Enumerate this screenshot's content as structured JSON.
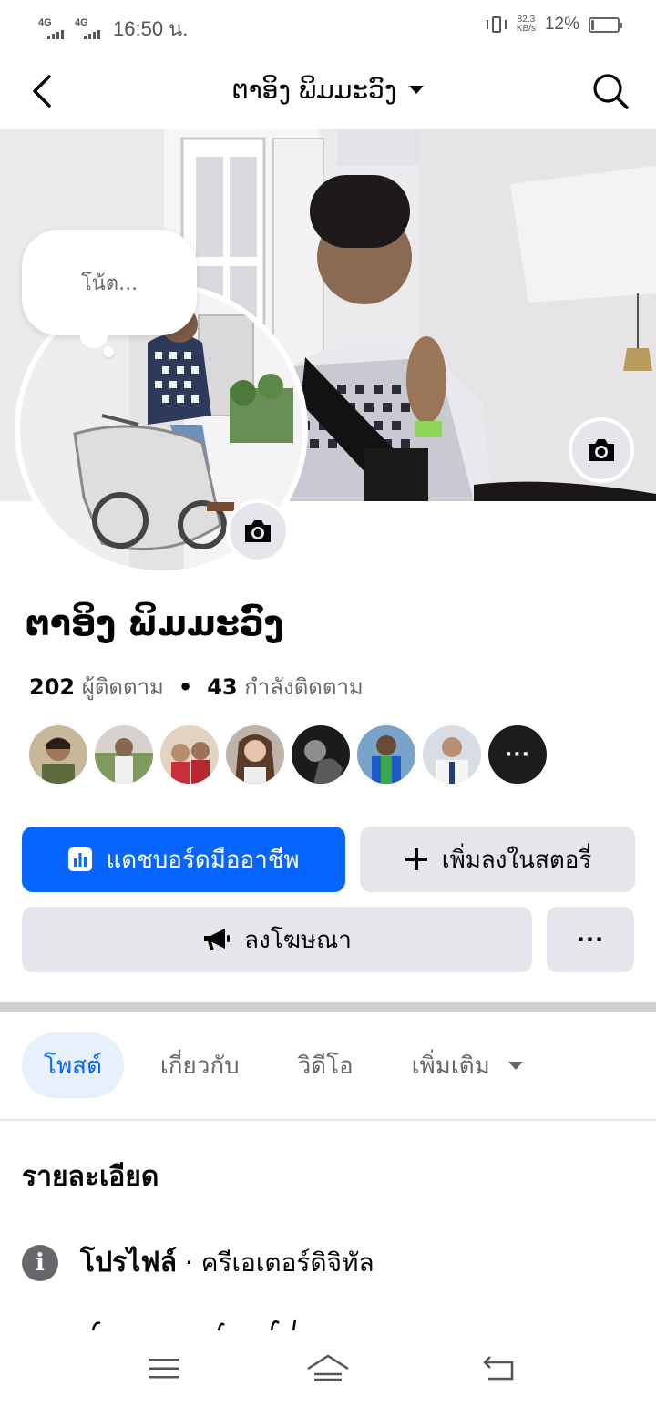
{
  "status_bar": {
    "network1": "4G",
    "network2": "4G",
    "time": "16:50 น.",
    "speed_value": "82.3",
    "speed_unit": "KB/s",
    "battery": "12%",
    "battery_level": 0.12
  },
  "header": {
    "title": "ຕາອິງ ພິມມະວົງ"
  },
  "note": {
    "placeholder": "โน้ต..."
  },
  "profile": {
    "name": "ຕາອິງ ພິມມະວົງ",
    "followers_count": "202",
    "followers_label": "ผู้ติดตาม",
    "following_count": "43",
    "following_label": "กำลังติดตาม",
    "separator": "•"
  },
  "buttons": {
    "dashboard": "แดชบอร์ดมืออาชีพ",
    "add_story": "เพิ่มลงในสตอรี่",
    "advertise": "ลงโฆษณา",
    "more": "···"
  },
  "avatars_more": "···",
  "tabs": [
    {
      "label": "โพสต์",
      "active": true
    },
    {
      "label": "เกี่ยวกับ",
      "active": false
    },
    {
      "label": "วิดีโอ",
      "active": false
    },
    {
      "label": "เพิ่มเติม",
      "active": false
    }
  ],
  "details": {
    "title": "รายละเอียด",
    "profile_label": "โปรไฟล์",
    "profile_sep": " · ",
    "profile_value": "ครีเอเตอร์ดิจิทัล"
  },
  "colors": {
    "primary": "#0866ff",
    "secondary_bg": "#e4e6eb",
    "text": "#050505",
    "muted": "#65676b"
  }
}
